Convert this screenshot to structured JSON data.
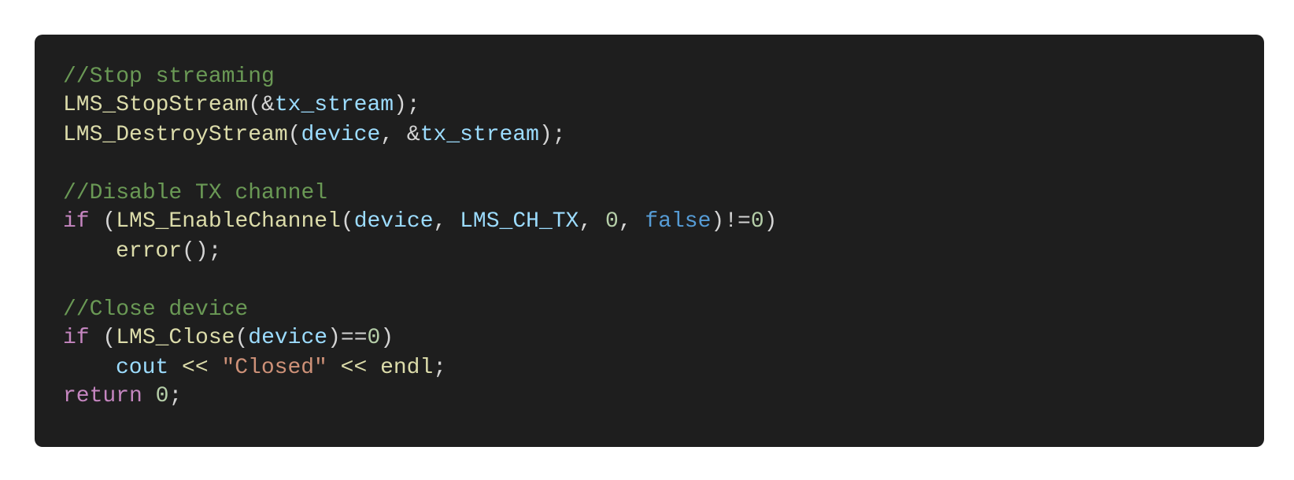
{
  "colors": {
    "background": "#1e1e1e",
    "comment": "#6a9955",
    "function": "#dcdcaa",
    "variable": "#9cdcfe",
    "control_keyword": "#c586c0",
    "literal_keyword": "#569cd6",
    "number": "#b5cea8",
    "string": "#ce9178",
    "punctuation": "#d4d4d4"
  },
  "code": {
    "comment_stop": "//Stop streaming",
    "fn_stop_stream": "LMS_StopStream",
    "amp1": "(&",
    "var_tx_stream_1": "tx_stream",
    "end1": ");",
    "fn_destroy_stream": "LMS_DestroyStream",
    "open_paren_2": "(",
    "var_device_1": "device",
    "comma_amp": ", &",
    "var_tx_stream_2": "tx_stream",
    "end2": ");",
    "comment_disable": "//Disable TX channel",
    "kw_if_1": "if",
    "space_paren_1": " (",
    "fn_enable_channel": "LMS_EnableChannel",
    "open_paren_3": "(",
    "var_device_2": "device",
    "comma_1": ", ",
    "var_lms_ch_tx": "LMS_CH_TX",
    "comma_2": ", ",
    "num_zero_1": "0",
    "comma_3": ", ",
    "kw_false": "false",
    "neq": ")!=",
    "num_zero_2": "0",
    "close_paren_1": ")",
    "fn_error": "error",
    "error_end": "();",
    "comment_close": "//Close device",
    "kw_if_2": "if",
    "space_paren_2": " (",
    "fn_lms_close": "LMS_Close",
    "open_paren_4": "(",
    "var_device_3": "device",
    "eq": ")==",
    "num_zero_3": "0",
    "close_paren_2": ")",
    "var_cout": "cout",
    "shift_1": " << ",
    "str_closed": "\"Closed\"",
    "shift_2": " << ",
    "fn_endl": "endl",
    "semi_1": ";",
    "kw_return": "return",
    "space_1": " ",
    "num_zero_4": "0",
    "semi_2": ";"
  }
}
